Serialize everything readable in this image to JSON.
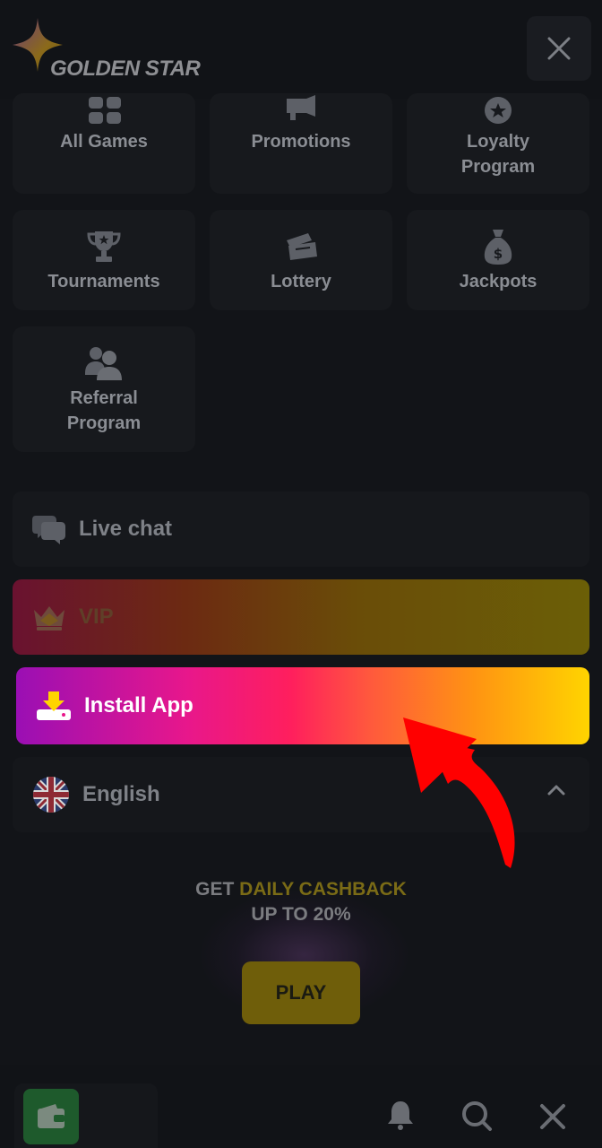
{
  "header": {
    "logo_text": "GOLDEN STAR",
    "close_icon": "close-icon"
  },
  "menu": {
    "tiles": [
      {
        "label": "All Games",
        "icon": "grid-icon"
      },
      {
        "label": "Promotions",
        "icon": "megaphone-icon"
      },
      {
        "label": "Loyalty\nProgram",
        "icon": "medal-icon"
      },
      {
        "label": "Tournaments",
        "icon": "trophy-icon"
      },
      {
        "label": "Lottery",
        "icon": "ticket-icon"
      },
      {
        "label": "Jackpots",
        "icon": "money-bag-icon"
      },
      {
        "label": "Referral\nProgram",
        "icon": "users-icon"
      }
    ],
    "live_chat": "Live chat",
    "vip": "VIP",
    "install_app": "Install App",
    "language": "English"
  },
  "promo": {
    "prefix": "GET ",
    "highlight": "DAILY CASHBACK",
    "line2": "UP TO 20%",
    "play": "PLAY"
  },
  "colors": {
    "background": "#121418",
    "accent_gold": "#ffd400",
    "accent_pink": "#e8178b",
    "arrow_red": "#ff0000"
  }
}
